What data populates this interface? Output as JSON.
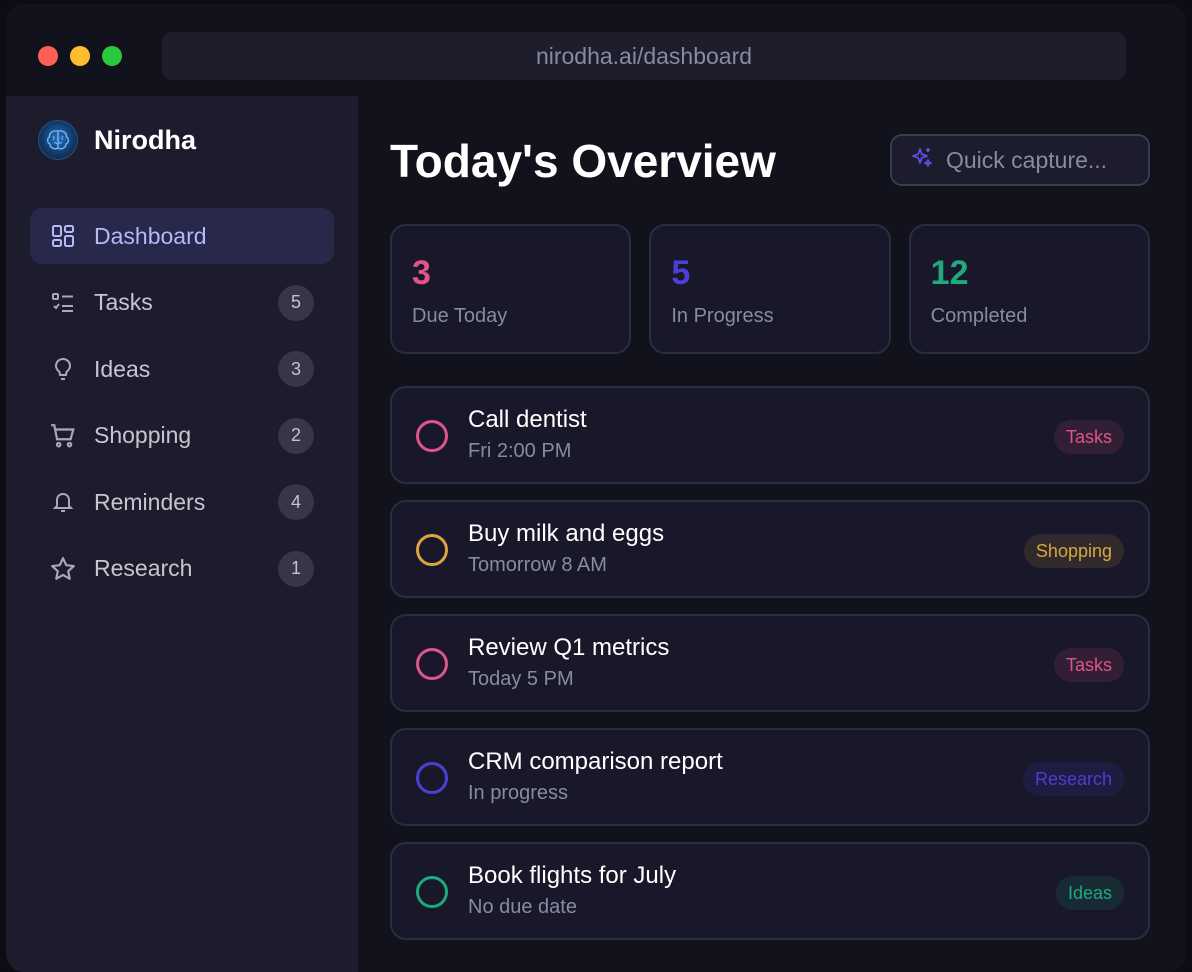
{
  "browser": {
    "url": "nirodha.ai/dashboard"
  },
  "sidebar": {
    "brand": "Nirodha",
    "items": [
      {
        "label": "Dashboard",
        "icon": "dashboard-grid-icon",
        "active": true
      },
      {
        "label": "Tasks",
        "icon": "task-list-icon",
        "count": "5"
      },
      {
        "label": "Ideas",
        "icon": "lightbulb-icon",
        "count": "3"
      },
      {
        "label": "Shopping",
        "icon": "cart-icon",
        "count": "2"
      },
      {
        "label": "Reminders",
        "icon": "bell-icon",
        "count": "4"
      },
      {
        "label": "Research",
        "icon": "star-icon",
        "count": "1"
      }
    ]
  },
  "main": {
    "title": "Today's Overview",
    "quick_capture": {
      "label": "Quick capture...",
      "icon": "sparkle-icon"
    },
    "stats": [
      {
        "value": "3",
        "label": "Due Today",
        "color": "#e0548a"
      },
      {
        "value": "5",
        "label": "In Progress",
        "color": "#4b3fd6"
      },
      {
        "value": "12",
        "label": "Completed",
        "color": "#1fa97c"
      }
    ],
    "tasks": [
      {
        "title": "Call dentist",
        "subtitle": "Fri 2:00 PM",
        "tag": "Tasks",
        "color": "#e0548a"
      },
      {
        "title": "Buy milk and eggs",
        "subtitle": "Tomorrow 8 AM",
        "tag": "Shopping",
        "color": "#d9a53e"
      },
      {
        "title": "Review Q1 metrics",
        "subtitle": "Today 5 PM",
        "tag": "Tasks",
        "color": "#e0548a"
      },
      {
        "title": "CRM comparison report",
        "subtitle": "In progress",
        "tag": "Research",
        "color": "#4b3fd6"
      },
      {
        "title": "Book flights for July",
        "subtitle": "No due date",
        "tag": "Ideas",
        "color": "#1fa97c"
      }
    ]
  }
}
